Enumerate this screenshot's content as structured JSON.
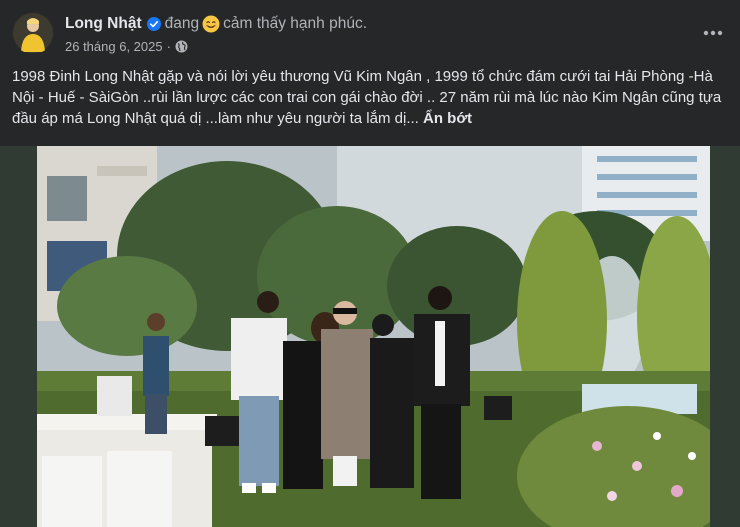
{
  "post": {
    "author": "Long Nhật",
    "feeling_prefix": "đang",
    "feeling_text": "cảm thấy hạnh phúc.",
    "date": "26 tháng 6, 2025",
    "separator": "·",
    "body": "1998 Đinh Long Nhật gặp và nói lời yêu thương Vũ Kim Ngân , 1999 tổ chức đám cưới tai Hải Phòng -Hà Nội - Huế - SàiGòn ..rùi lần lược các con trai con gái chào đời .. 27 năm rùi mà lúc nào Kim Ngân cũng tựa đầu áp má Long Nhật quá dị ...làm như yêu người ta lắm dị...",
    "see_less": "Ẩn bớt"
  },
  "icons": {
    "verified": "verified-badge-icon",
    "feeling": "smiling-emoji-icon",
    "privacy": "globe-icon",
    "more": "more-options-icon"
  },
  "colors": {
    "background": "#252728",
    "text": "#e4e6eb",
    "secondary_text": "#b0b3b8",
    "verified": "#1877f2"
  }
}
